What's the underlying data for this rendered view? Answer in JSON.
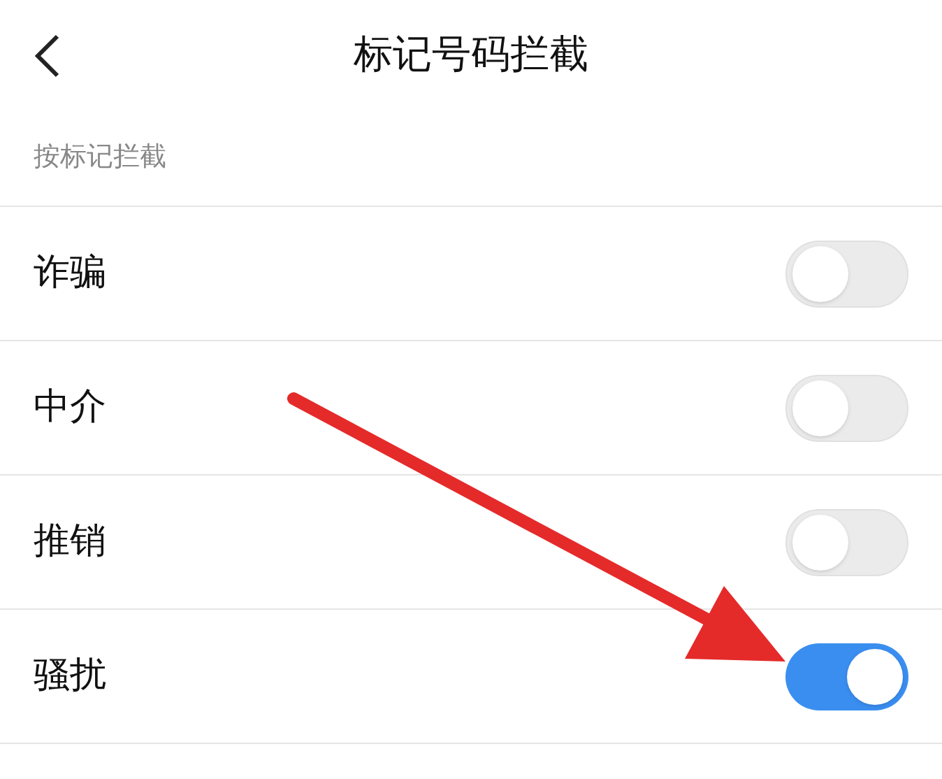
{
  "header": {
    "title": "标记号码拦截"
  },
  "section": {
    "title": "按标记拦截"
  },
  "items": [
    {
      "label": "诈骗",
      "on": false
    },
    {
      "label": "中介",
      "on": false
    },
    {
      "label": "推销",
      "on": false
    },
    {
      "label": "骚扰",
      "on": true
    }
  ]
}
